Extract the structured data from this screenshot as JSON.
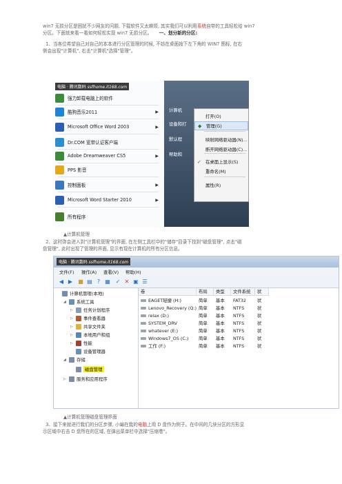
{
  "paragraphs": {
    "intro_line1": "win7 无损分区是困扰不少网友的问题, 下载软件又太麻烦, 其实我们可以利用",
    "intro_red": "系统",
    "intro_line1b": "自带的工具轻松给 win7",
    "intro_line2": "分区。下面就来看一看如何轻松实现 win7 无损分区。",
    "section_title": "一、划分新的分区:",
    "step1_line1": "1、当各位希望自己对自己的本本进行分区管理的时候, 不妨在桌面按下左下角的 WIN7 图标, 在右",
    "step1_line2": "侧会出现\"计算机\", 右击\"计算机\"选择\"管理\"。",
    "caption1": "▲计算机管理",
    "step2_line1": "2、这时弥会进入到\"计算机管理\"的界面, 在左侧工具栏中的\"储存\"目录下找到\"磁盘管理\", 点击\"磁",
    "step2_line2": "盘管理\", 此时出现了管理的界面, 显示有现在计算机的所有分区信息。",
    "caption2": "▲计算机管理磁盘管理界面",
    "step3_line1a": "3、接下来就进行我们的分区步骤, 小编在我的",
    "step3_red": "电脑",
    "step3_line1b": "上用 D 盘作为例子。在中间的几块分区的方形显",
    "step3_line2": "示区域中右击 D 盘所在的区域, 在弹出菜单栏中选择\"压缩卷\"。"
  },
  "watermark": {
    "label": "电脑 · 腾讯数码",
    "url": "ssfhome.it168.com"
  },
  "start_menu": {
    "items": [
      {
        "label": "强力卸载电脑上的软件",
        "icon": "uninstall-icon",
        "color": "#3b8d3b"
      },
      {
        "label": "酷狗音乐2011",
        "icon": "kugou-icon",
        "color": "#1e84d8",
        "arrow": "▶"
      },
      {
        "label": "Microsoft Office Word 2003",
        "icon": "word-icon",
        "color": "#2b5fb4",
        "arrow": "▶"
      },
      {
        "label": "Dr.COM 宽带认证客户端",
        "icon": "drcom-icon",
        "color": "#2b8ecf",
        "arrow": ""
      },
      {
        "label": "Adobe Dreamweaver CS5",
        "icon": "dreamweaver-icon",
        "color": "#3d8a3d",
        "arrow": "▶"
      },
      {
        "label": "PPS 影音",
        "icon": "pps-icon",
        "color": "#e4a91a",
        "arrow": ""
      },
      {
        "label": "控制面板",
        "icon": "control-panel-icon",
        "color": "#3a78c2",
        "arrow": "▶"
      },
      {
        "label": "Microsoft Word Starter 2010",
        "icon": "word-starter-icon",
        "color": "#2b5fb4",
        "arrow": "▶"
      },
      {
        "label": "所有程序",
        "icon": "all-programs-icon",
        "color": "#4a7e2e",
        "arrow": ""
      }
    ],
    "right_items": {
      "computer": "计算机",
      "devices": "设备和打",
      "defaults": "默认程",
      "help": "帮助和"
    }
  },
  "context_menu": {
    "items": [
      "打开(O)",
      "管理(G)",
      "映射网络驱动器(N)...",
      "断开网络驱动器(C)...",
      "在桌面上显示(S)",
      "重命名(M)",
      "属性(R)"
    ],
    "check": "✓"
  },
  "comp_mgmt": {
    "menu": [
      "文件(F)",
      "操作(A)",
      "查看(V)",
      "帮助(H)"
    ],
    "tree": [
      {
        "label": "计算机管理(本地)",
        "level": 0,
        "icon_color": "#6d8fb3"
      },
      {
        "label": "系统工具",
        "level": 1,
        "icon_color": "#6d8fb3",
        "expander": "◢"
      },
      {
        "label": "任务计划程序",
        "level": 2,
        "icon_color": "#8a9cb3",
        "expander": "▷"
      },
      {
        "label": "事件查看器",
        "level": 2,
        "icon_color": "#b05a3c",
        "expander": "▷"
      },
      {
        "label": "共享文件夹",
        "level": 2,
        "icon_color": "#e0b13f",
        "expander": "▷"
      },
      {
        "label": "本地用户和组",
        "level": 2,
        "icon_color": "#5b84b8",
        "expander": "▷"
      },
      {
        "label": "性能",
        "level": 2,
        "icon_color": "#a23f3f",
        "expander": "▷"
      },
      {
        "label": "设备管理器",
        "level": 2,
        "icon_color": "#6a8fb8",
        "expander": ""
      },
      {
        "label": "存储",
        "level": 1,
        "icon_color": "#7d8ea3",
        "expander": "◢"
      },
      {
        "label": "磁盘管理",
        "level": 2,
        "icon_color": "#7d8ea3",
        "expander": "",
        "selected": true
      },
      {
        "label": "服务和应用程序",
        "level": 1,
        "icon_color": "#7d8ea3",
        "expander": "▷"
      }
    ],
    "columns": [
      "卷",
      "布局",
      "类型",
      "文件系统",
      "状"
    ],
    "rows": [
      {
        "vol": "EAGET轻捷 (H:)",
        "layout": "简单",
        "type": "基本",
        "fs": "FAT32",
        "st": "状"
      },
      {
        "vol": "Lenovo_Recovery (Q:)",
        "layout": "简单",
        "type": "基本",
        "fs": "NTFS",
        "st": "状"
      },
      {
        "vol": "relax (D:)",
        "layout": "简单",
        "type": "基本",
        "fs": "NTFS",
        "st": "状"
      },
      {
        "vol": "SYSTEM_DRV",
        "layout": "简单",
        "type": "基本",
        "fs": "NTFS",
        "st": "状"
      },
      {
        "vol": "whatever (E:)",
        "layout": "简单",
        "type": "基本",
        "fs": "NTFS",
        "st": "状"
      },
      {
        "vol": "Windows7_OS (C:)",
        "layout": "简单",
        "type": "基本",
        "fs": "NTFS",
        "st": "状"
      },
      {
        "vol": "工作 (F:)",
        "layout": "简单",
        "type": "基本",
        "fs": "NTFS",
        "st": "状"
      }
    ]
  },
  "colors": {
    "accent_red": "#c0392b",
    "selection_yellow": "#f7f21a",
    "menu_highlight": "#dce8f7"
  }
}
